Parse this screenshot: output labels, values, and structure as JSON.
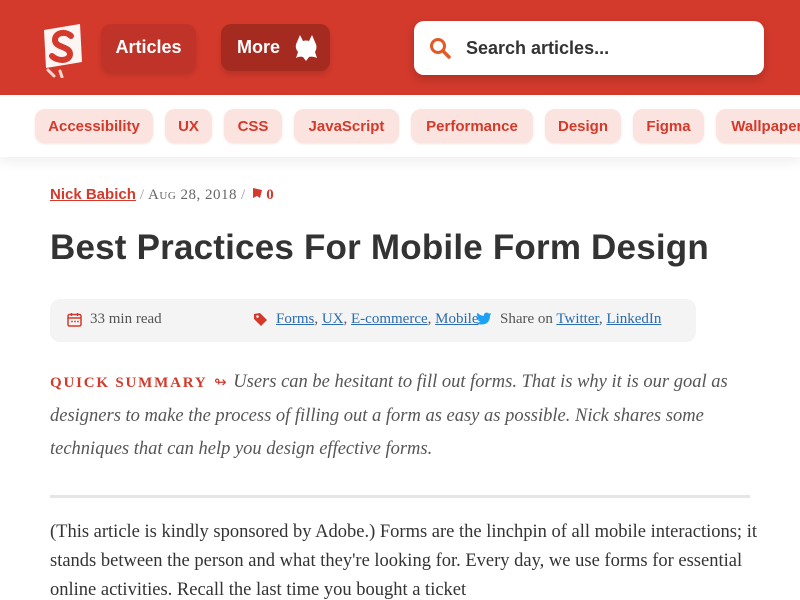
{
  "header": {
    "brand_color": "#d33a2c",
    "logo_icon": "smashing-logo-icon",
    "nav": [
      {
        "label": "Articles"
      },
      {
        "label": "More",
        "icon": "cat-icon"
      }
    ],
    "search": {
      "placeholder": "Search articles...",
      "value": "",
      "icon": "search-icon"
    }
  },
  "tags": [
    "Accessibility",
    "UX",
    "CSS",
    "JavaScript",
    "Performance",
    "Design",
    "Figma",
    "Wallpapers"
  ],
  "article": {
    "author": "Nick Babich",
    "date": "Aug 28, 2018",
    "comments": "0",
    "comments_icon": "comment-icon",
    "title": "Best Practices For Mobile Form Design",
    "read_time": "33 min read",
    "topics": [
      "Forms",
      "UX",
      "E-commerce",
      "Mobile"
    ],
    "share_label": "Share on",
    "share_links": [
      "Twitter",
      "LinkedIn"
    ],
    "summary_label": "Quick summary",
    "summary_arrow": "↬",
    "summary_text": "Users can be hesitant to fill out forms. That is why it is our goal as designers to make the process of filling out a form as easy as possible. Nick shares some techniques that can help you design effective forms.",
    "body_text": "(This article is kindly sponsored by Adobe.) Forms are the linchpin of all mobile interactions; it stands between the person and what they're looking for. Every day, we use forms for essential online activities. Recall the last time you bought a ticket"
  }
}
